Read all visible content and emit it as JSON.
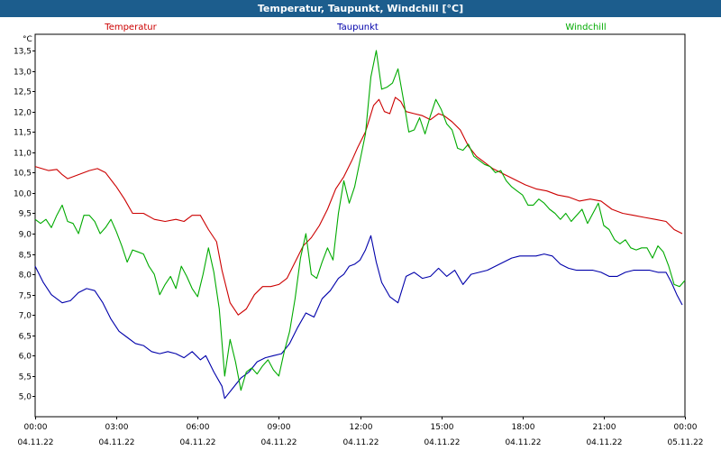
{
  "window": {
    "title": "Temperatur, Taupunkt, Windchill [°C]"
  },
  "chart_data": {
    "type": "line",
    "title": "Temperatur, Taupunkt, Windchill [°C]",
    "ylabel": "°C",
    "xlim": [
      0,
      24
    ],
    "ylim": [
      4.5,
      13.9
    ],
    "grid": true,
    "x_ticks": [
      {
        "x": 0,
        "time": "00:00",
        "date": "04.11.22"
      },
      {
        "x": 3,
        "time": "03:00",
        "date": "04.11.22"
      },
      {
        "x": 6,
        "time": "06:00",
        "date": "04.11.22"
      },
      {
        "x": 9,
        "time": "09:00",
        "date": "04.11.22"
      },
      {
        "x": 12,
        "time": "12:00",
        "date": "04.11.22"
      },
      {
        "x": 15,
        "time": "15:00",
        "date": "04.11.22"
      },
      {
        "x": 18,
        "time": "18:00",
        "date": "04.11.22"
      },
      {
        "x": 21,
        "time": "21:00",
        "date": "04.11.22"
      },
      {
        "x": 24,
        "time": "00:00",
        "date": "05.11.22"
      }
    ],
    "y_ticks": [
      "5,0",
      "5,5",
      "6,0",
      "6,5",
      "7,0",
      "7,5",
      "8,0",
      "8,5",
      "9,0",
      "9,5",
      "10,0",
      "10,5",
      "11,0",
      "11,5",
      "12,0",
      "12,5",
      "13,0",
      "13,5"
    ],
    "y_tick_values": [
      5.0,
      5.5,
      6.0,
      6.5,
      7.0,
      7.5,
      8.0,
      8.5,
      9.0,
      9.5,
      10.0,
      10.5,
      11.0,
      11.5,
      12.0,
      12.5,
      13.0,
      13.5
    ],
    "series": [
      {
        "name": "Temperatur",
        "color": "#cc0000",
        "points": [
          [
            0,
            10.65
          ],
          [
            0.5,
            10.55
          ],
          [
            0.8,
            10.58
          ],
          [
            1.0,
            10.45
          ],
          [
            1.2,
            10.35
          ],
          [
            1.6,
            10.45
          ],
          [
            2.0,
            10.55
          ],
          [
            2.3,
            10.6
          ],
          [
            2.6,
            10.5
          ],
          [
            3.0,
            10.15
          ],
          [
            3.3,
            9.85
          ],
          [
            3.6,
            9.5
          ],
          [
            4.0,
            9.5
          ],
          [
            4.4,
            9.35
          ],
          [
            4.8,
            9.3
          ],
          [
            5.2,
            9.35
          ],
          [
            5.5,
            9.3
          ],
          [
            5.8,
            9.45
          ],
          [
            6.1,
            9.45
          ],
          [
            6.4,
            9.1
          ],
          [
            6.7,
            8.8
          ],
          [
            6.9,
            8.1
          ],
          [
            7.2,
            7.3
          ],
          [
            7.5,
            7.0
          ],
          [
            7.8,
            7.15
          ],
          [
            8.1,
            7.5
          ],
          [
            8.4,
            7.7
          ],
          [
            8.7,
            7.7
          ],
          [
            9.0,
            7.75
          ],
          [
            9.3,
            7.9
          ],
          [
            9.6,
            8.3
          ],
          [
            9.9,
            8.7
          ],
          [
            10.2,
            8.9
          ],
          [
            10.5,
            9.2
          ],
          [
            10.8,
            9.6
          ],
          [
            11.1,
            10.1
          ],
          [
            11.4,
            10.4
          ],
          [
            11.7,
            10.8
          ],
          [
            11.9,
            11.1
          ],
          [
            12.2,
            11.5
          ],
          [
            12.5,
            12.15
          ],
          [
            12.7,
            12.3
          ],
          [
            12.9,
            12.0
          ],
          [
            13.1,
            11.95
          ],
          [
            13.3,
            12.35
          ],
          [
            13.5,
            12.25
          ],
          [
            13.7,
            12.0
          ],
          [
            14.0,
            11.95
          ],
          [
            14.3,
            11.9
          ],
          [
            14.6,
            11.8
          ],
          [
            14.9,
            11.95
          ],
          [
            15.1,
            11.9
          ],
          [
            15.4,
            11.75
          ],
          [
            15.7,
            11.55
          ],
          [
            16.0,
            11.15
          ],
          [
            16.3,
            10.9
          ],
          [
            16.6,
            10.75
          ],
          [
            16.9,
            10.6
          ],
          [
            17.2,
            10.5
          ],
          [
            17.5,
            10.4
          ],
          [
            17.8,
            10.3
          ],
          [
            18.1,
            10.2
          ],
          [
            18.5,
            10.1
          ],
          [
            18.9,
            10.05
          ],
          [
            19.3,
            9.95
          ],
          [
            19.7,
            9.9
          ],
          [
            20.1,
            9.8
          ],
          [
            20.5,
            9.85
          ],
          [
            20.9,
            9.8
          ],
          [
            21.3,
            9.6
          ],
          [
            21.7,
            9.5
          ],
          [
            22.1,
            9.45
          ],
          [
            22.5,
            9.4
          ],
          [
            22.9,
            9.35
          ],
          [
            23.3,
            9.3
          ],
          [
            23.6,
            9.1
          ],
          [
            23.9,
            9.0
          ]
        ]
      },
      {
        "name": "Taupunkt",
        "color": "#0000aa",
        "points": [
          [
            0,
            8.2
          ],
          [
            0.3,
            7.8
          ],
          [
            0.6,
            7.5
          ],
          [
            1.0,
            7.3
          ],
          [
            1.3,
            7.35
          ],
          [
            1.6,
            7.55
          ],
          [
            1.9,
            7.65
          ],
          [
            2.2,
            7.6
          ],
          [
            2.5,
            7.3
          ],
          [
            2.8,
            6.9
          ],
          [
            3.1,
            6.6
          ],
          [
            3.4,
            6.45
          ],
          [
            3.7,
            6.3
          ],
          [
            4.0,
            6.25
          ],
          [
            4.3,
            6.1
          ],
          [
            4.6,
            6.05
          ],
          [
            4.9,
            6.1
          ],
          [
            5.2,
            6.05
          ],
          [
            5.5,
            5.95
          ],
          [
            5.8,
            6.1
          ],
          [
            6.1,
            5.9
          ],
          [
            6.3,
            6.0
          ],
          [
            6.6,
            5.6
          ],
          [
            6.9,
            5.25
          ],
          [
            7.0,
            4.95
          ],
          [
            7.3,
            5.2
          ],
          [
            7.6,
            5.45
          ],
          [
            7.9,
            5.6
          ],
          [
            8.2,
            5.85
          ],
          [
            8.5,
            5.95
          ],
          [
            8.8,
            6.0
          ],
          [
            9.1,
            6.05
          ],
          [
            9.4,
            6.3
          ],
          [
            9.7,
            6.7
          ],
          [
            10.0,
            7.05
          ],
          [
            10.3,
            6.95
          ],
          [
            10.6,
            7.4
          ],
          [
            10.9,
            7.6
          ],
          [
            11.2,
            7.9
          ],
          [
            11.4,
            8.0
          ],
          [
            11.6,
            8.2
          ],
          [
            11.8,
            8.25
          ],
          [
            12.0,
            8.35
          ],
          [
            12.2,
            8.6
          ],
          [
            12.4,
            8.95
          ],
          [
            12.6,
            8.3
          ],
          [
            12.8,
            7.8
          ],
          [
            13.1,
            7.45
          ],
          [
            13.4,
            7.3
          ],
          [
            13.7,
            7.95
          ],
          [
            14.0,
            8.05
          ],
          [
            14.3,
            7.9
          ],
          [
            14.6,
            7.95
          ],
          [
            14.9,
            8.15
          ],
          [
            15.2,
            7.95
          ],
          [
            15.5,
            8.1
          ],
          [
            15.8,
            7.75
          ],
          [
            16.1,
            8.0
          ],
          [
            16.4,
            8.05
          ],
          [
            16.7,
            8.1
          ],
          [
            17.0,
            8.2
          ],
          [
            17.3,
            8.3
          ],
          [
            17.6,
            8.4
          ],
          [
            17.9,
            8.45
          ],
          [
            18.2,
            8.45
          ],
          [
            18.5,
            8.45
          ],
          [
            18.8,
            8.5
          ],
          [
            19.1,
            8.45
          ],
          [
            19.4,
            8.25
          ],
          [
            19.7,
            8.15
          ],
          [
            20.0,
            8.1
          ],
          [
            20.3,
            8.1
          ],
          [
            20.6,
            8.1
          ],
          [
            20.9,
            8.05
          ],
          [
            21.2,
            7.95
          ],
          [
            21.5,
            7.95
          ],
          [
            21.8,
            8.05
          ],
          [
            22.1,
            8.1
          ],
          [
            22.4,
            8.1
          ],
          [
            22.7,
            8.1
          ],
          [
            23.0,
            8.05
          ],
          [
            23.3,
            8.05
          ],
          [
            23.5,
            7.8
          ],
          [
            23.7,
            7.5
          ],
          [
            23.9,
            7.25
          ]
        ]
      },
      {
        "name": "Windchill",
        "color": "#00aa00",
        "points": [
          [
            0,
            9.35
          ],
          [
            0.2,
            9.25
          ],
          [
            0.4,
            9.35
          ],
          [
            0.6,
            9.15
          ],
          [
            0.8,
            9.45
          ],
          [
            1.0,
            9.7
          ],
          [
            1.2,
            9.3
          ],
          [
            1.4,
            9.25
          ],
          [
            1.6,
            9.0
          ],
          [
            1.8,
            9.45
          ],
          [
            2.0,
            9.45
          ],
          [
            2.2,
            9.3
          ],
          [
            2.4,
            9.0
          ],
          [
            2.6,
            9.15
          ],
          [
            2.8,
            9.35
          ],
          [
            3.0,
            9.05
          ],
          [
            3.2,
            8.7
          ],
          [
            3.4,
            8.3
          ],
          [
            3.6,
            8.6
          ],
          [
            3.8,
            8.55
          ],
          [
            4.0,
            8.5
          ],
          [
            4.2,
            8.2
          ],
          [
            4.4,
            8.0
          ],
          [
            4.6,
            7.5
          ],
          [
            4.8,
            7.75
          ],
          [
            5.0,
            7.95
          ],
          [
            5.2,
            7.65
          ],
          [
            5.4,
            8.2
          ],
          [
            5.6,
            7.95
          ],
          [
            5.8,
            7.65
          ],
          [
            6.0,
            7.45
          ],
          [
            6.2,
            8.0
          ],
          [
            6.4,
            8.65
          ],
          [
            6.6,
            8.05
          ],
          [
            6.8,
            7.15
          ],
          [
            7.0,
            5.5
          ],
          [
            7.2,
            6.4
          ],
          [
            7.4,
            5.85
          ],
          [
            7.6,
            5.15
          ],
          [
            7.8,
            5.6
          ],
          [
            8.0,
            5.7
          ],
          [
            8.2,
            5.55
          ],
          [
            8.4,
            5.75
          ],
          [
            8.6,
            5.9
          ],
          [
            8.8,
            5.65
          ],
          [
            9.0,
            5.5
          ],
          [
            9.2,
            6.1
          ],
          [
            9.4,
            6.6
          ],
          [
            9.6,
            7.4
          ],
          [
            9.8,
            8.4
          ],
          [
            10.0,
            9.0
          ],
          [
            10.2,
            8.0
          ],
          [
            10.4,
            7.9
          ],
          [
            10.6,
            8.3
          ],
          [
            10.8,
            8.65
          ],
          [
            11.0,
            8.35
          ],
          [
            11.2,
            9.5
          ],
          [
            11.4,
            10.3
          ],
          [
            11.6,
            9.75
          ],
          [
            11.8,
            10.15
          ],
          [
            12.0,
            10.8
          ],
          [
            12.2,
            11.45
          ],
          [
            12.4,
            12.85
          ],
          [
            12.6,
            13.5
          ],
          [
            12.8,
            12.55
          ],
          [
            13.0,
            12.6
          ],
          [
            13.2,
            12.7
          ],
          [
            13.4,
            13.05
          ],
          [
            13.6,
            12.3
          ],
          [
            13.8,
            11.5
          ],
          [
            14.0,
            11.55
          ],
          [
            14.2,
            11.85
          ],
          [
            14.4,
            11.45
          ],
          [
            14.6,
            11.9
          ],
          [
            14.8,
            12.3
          ],
          [
            15.0,
            12.05
          ],
          [
            15.2,
            11.7
          ],
          [
            15.4,
            11.55
          ],
          [
            15.6,
            11.1
          ],
          [
            15.8,
            11.05
          ],
          [
            16.0,
            11.2
          ],
          [
            16.2,
            10.9
          ],
          [
            16.4,
            10.8
          ],
          [
            16.6,
            10.7
          ],
          [
            16.8,
            10.65
          ],
          [
            17.0,
            10.5
          ],
          [
            17.2,
            10.55
          ],
          [
            17.4,
            10.3
          ],
          [
            17.6,
            10.15
          ],
          [
            17.8,
            10.05
          ],
          [
            18.0,
            9.95
          ],
          [
            18.2,
            9.7
          ],
          [
            18.4,
            9.7
          ],
          [
            18.6,
            9.85
          ],
          [
            18.8,
            9.75
          ],
          [
            19.0,
            9.6
          ],
          [
            19.2,
            9.5
          ],
          [
            19.4,
            9.35
          ],
          [
            19.6,
            9.5
          ],
          [
            19.8,
            9.3
          ],
          [
            20.0,
            9.45
          ],
          [
            20.2,
            9.6
          ],
          [
            20.4,
            9.25
          ],
          [
            20.6,
            9.5
          ],
          [
            20.8,
            9.75
          ],
          [
            21.0,
            9.2
          ],
          [
            21.2,
            9.1
          ],
          [
            21.4,
            8.85
          ],
          [
            21.6,
            8.75
          ],
          [
            21.8,
            8.85
          ],
          [
            22.0,
            8.65
          ],
          [
            22.2,
            8.6
          ],
          [
            22.4,
            8.65
          ],
          [
            22.6,
            8.65
          ],
          [
            22.8,
            8.4
          ],
          [
            23.0,
            8.7
          ],
          [
            23.2,
            8.55
          ],
          [
            23.4,
            8.2
          ],
          [
            23.6,
            7.75
          ],
          [
            23.8,
            7.7
          ],
          [
            24.0,
            7.85
          ]
        ]
      }
    ]
  }
}
